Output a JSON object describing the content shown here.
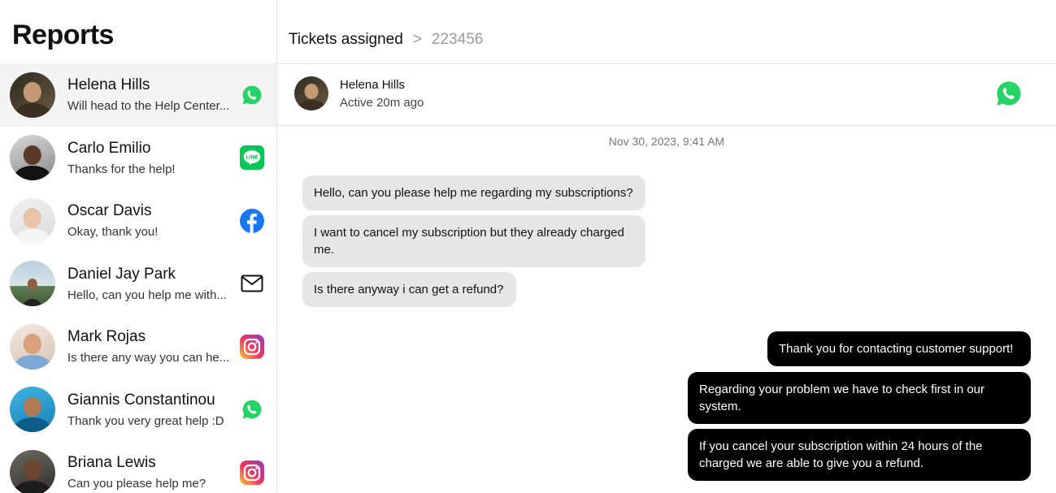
{
  "sidebar": {
    "title": "Reports",
    "items": [
      {
        "name": "Helena Hills",
        "preview": "Will head to the Help Center...",
        "channel": "whatsapp-icon"
      },
      {
        "name": "Carlo Emilio",
        "preview": "Thanks for the help!",
        "channel": "line-icon"
      },
      {
        "name": "Oscar Davis",
        "preview": "Okay, thank you!",
        "channel": "facebook-icon"
      },
      {
        "name": "Daniel Jay Park",
        "preview": "Hello, can you help me with...",
        "channel": "email-icon"
      },
      {
        "name": "Mark Rojas",
        "preview": "Is there any way you can he...",
        "channel": "instagram-icon"
      },
      {
        "name": "Giannis Constantinou",
        "preview": "Thank you very great help :D",
        "channel": "whatsapp-icon"
      },
      {
        "name": "Briana Lewis",
        "preview": "Can you please help me?",
        "channel": "instagram-icon"
      }
    ]
  },
  "breadcrumb": {
    "root": "Tickets assigned",
    "separator": ">",
    "ticket_id": "223456"
  },
  "chat": {
    "contact_name": "Helena Hills",
    "status": "Active 20m ago",
    "channel": "whatsapp-icon",
    "timestamp": "Nov 30, 2023, 9:41 AM",
    "messages": [
      {
        "direction": "in",
        "text": "Hello, can you please help me regarding my subscriptions?"
      },
      {
        "direction": "in",
        "text": "I want to cancel my subscription but they already charged me."
      },
      {
        "direction": "in",
        "text": "Is there anyway i can get a refund?"
      },
      {
        "direction": "out",
        "text": "Thank you for contacting customer support!"
      },
      {
        "direction": "out",
        "text": "Regarding your problem we have to check first in our system."
      },
      {
        "direction": "out",
        "text": "If you cancel your subscription within 24 hours of the charged we are able to give you a refund."
      }
    ]
  },
  "colors": {
    "whatsapp": "#25D366",
    "line": "#06C755",
    "facebook": "#1877F2",
    "outgoing_bubble": "#000000",
    "incoming_bubble": "#E6E6E6"
  }
}
